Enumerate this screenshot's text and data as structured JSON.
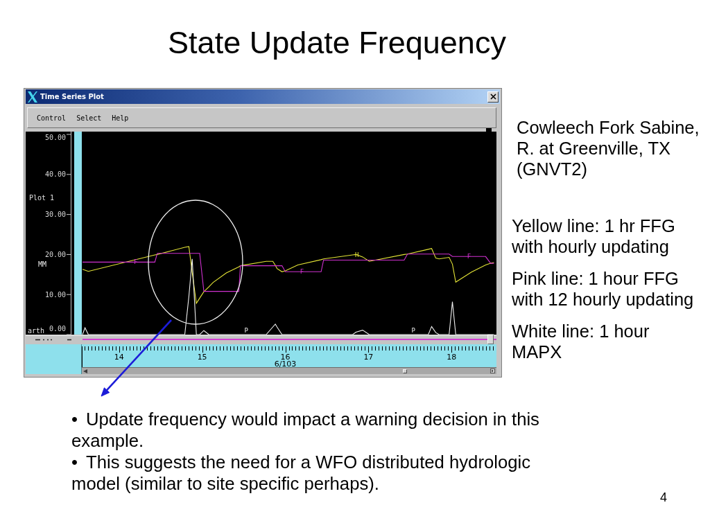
{
  "slide": {
    "title": "State Update Frequency"
  },
  "window": {
    "title": "Time Series Plot",
    "menu": [
      {
        "label": "Control"
      },
      {
        "label": "Select"
      },
      {
        "label": "Help"
      }
    ],
    "plot": {
      "plot_label": "Plot 1",
      "unit_label": "MM",
      "station_label": "arth",
      "date_label": "6/103",
      "chart_data": {
        "type": "line",
        "x": [
          13.56,
          13.59,
          13.63,
          14.43,
          14.46,
          14.79,
          14.84,
          14.88,
          14.93,
          14.97,
          15.02,
          15.08,
          15.13,
          15.29,
          15.44,
          15.46,
          15.77,
          15.85,
          15.88,
          15.9,
          15.96,
          16.0,
          16.15,
          16.43,
          16.46,
          16.81,
          16.85,
          16.93,
          17.01,
          17.43,
          17.47,
          17.72,
          17.76,
          17.81,
          17.85,
          17.97,
          18.01,
          18.05,
          18.24,
          18.41,
          18.47,
          18.51
        ],
        "series": [
          {
            "color": "#e4e436",
            "values": [
              16.3,
              16.1,
              15.8,
              19.9,
              20.0,
              21.8,
              22.0,
              15.5,
              7.8,
              9.1,
              10.7,
              11.9,
              13.0,
              15.4,
              16.9,
              17.2,
              18.3,
              18.3,
              17.3,
              16.5,
              15.7,
              15.9,
              17.4,
              18.7,
              18.9,
              19.9,
              20.0,
              19.4,
              18.3,
              20.0,
              20.1,
              21.3,
              21.5,
              19.1,
              18.9,
              19.3,
              17.6,
              13.1,
              15.6,
              17.4,
              17.8,
              18.0
            ]
          },
          {
            "color": "#d030d0",
            "values": [
              18.1,
              18.1,
              18.1,
              18.1,
              20.3,
              20.3,
              20.3,
              20.3,
              20.3,
              20.3,
              10.8,
              10.8,
              10.8,
              10.8,
              10.8,
              17.2,
              17.2,
              17.2,
              17.2,
              17.2,
              17.2,
              15.7,
              15.7,
              15.7,
              18.6,
              18.6,
              18.6,
              18.6,
              18.6,
              18.6,
              20.1,
              20.1,
              20.1,
              20.1,
              20.1,
              20.1,
              19.5,
              19.5,
              19.5,
              19.5,
              17.8,
              17.8
            ]
          },
          {
            "color": "#f0f0f0",
            "values": [
              0,
              1.7,
              0,
              0,
              0,
              0,
              9.5,
              18.9,
              0,
              0,
              1.0,
              0,
              0,
              0,
              0,
              0,
              0,
              1.9,
              2.6,
              1.9,
              0,
              0,
              0,
              0,
              0,
              0,
              0.6,
              1.1,
              0,
              0,
              0,
              0,
              2.0,
              0.5,
              0,
              0,
              8.2,
              0,
              0,
              0,
              0,
              0
            ]
          }
        ],
        "xlim": [
          13.56,
          18.54
        ],
        "ylim": [
          0,
          50.7
        ],
        "xticks": [
          14,
          15,
          16,
          17,
          18
        ],
        "yticks": [
          {
            "value": 0,
            "label": "0.00"
          },
          {
            "value": 10,
            "label": "10.00"
          },
          {
            "value": 20,
            "label": "20.00"
          },
          {
            "value": 30,
            "label": "30.00"
          },
          {
            "value": 40,
            "label": "40.00"
          },
          {
            "value": 50,
            "label": "50.00"
          }
        ],
        "annotations": [
          {
            "x": 14.2,
            "y": 18.1,
            "text": "F"
          },
          {
            "x": 15.53,
            "y": 0,
            "text": "P"
          },
          {
            "x": 16.2,
            "y": 15.7,
            "text": "F"
          },
          {
            "x": 16.86,
            "y": 19.9,
            "text": "H"
          },
          {
            "x": 17.54,
            "y": 0,
            "text": "P"
          },
          {
            "x": 18.21,
            "y": 19.5,
            "text": "F"
          }
        ]
      }
    }
  },
  "station_description": {
    "lines": [
      "Cowleech Fork Sabine,",
      "R. at Greenville, TX",
      "(GNVT2)"
    ]
  },
  "legend": [
    {
      "lines": [
        "Yellow line: 1 hr FFG",
        "with hourly updating"
      ]
    },
    {
      "lines": [
        "Pink line: 1 hour FFG",
        "with 12 hourly updating"
      ]
    },
    {
      "lines": [
        "White line: 1 hour",
        "MAPX"
      ]
    }
  ],
  "bullets": [
    {
      "marker": "•",
      "text": "Update frequency would impact a warning decision in this example."
    },
    {
      "marker": "•",
      "text": "This suggests the need for a WFO distributed hydrologic model (similar to site specific perhaps)."
    }
  ],
  "page_number": "4"
}
